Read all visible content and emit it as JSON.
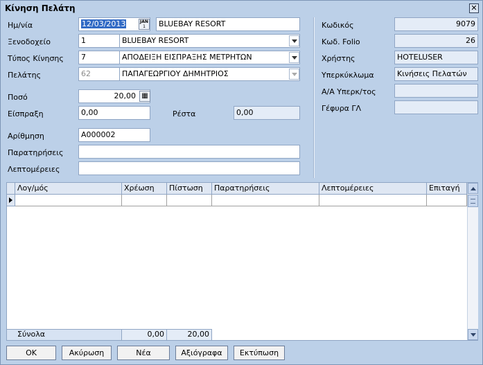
{
  "window": {
    "title": "Κίνηση Πελάτη",
    "close_glyph": "✕"
  },
  "form": {
    "date": {
      "label": "Ημ/νία",
      "value": "12/03/2013"
    },
    "hotel": {
      "label": "Ξενοδοχείο",
      "code": "1",
      "name": "BLUEBAY RESORT",
      "display": "BLUEBAY RESORT"
    },
    "movement_type": {
      "label": "Τύπος Κίνησης",
      "code": "7",
      "name": "ΑΠΟΔΕΙΞΗ ΕΙΣΠΡΑΞΗΣ ΜΕΤΡΗΤΩΝ"
    },
    "customer": {
      "label": "Πελάτης",
      "code": "62",
      "name": "ΠΑΠΑΓΕΩΡΓΙΟΥ ΔΗΜΗΤΡΙΟΣ"
    },
    "amount": {
      "label": "Ποσό",
      "value": "20,00"
    },
    "collection": {
      "label": "Είσπραξη",
      "value": "0,00"
    },
    "change": {
      "label": "Ρέστα",
      "value": "0,00"
    },
    "number": {
      "label": "Αρίθμηση",
      "value": "A000002"
    },
    "remarks": {
      "label": "Παρατηρήσεις",
      "value": ""
    },
    "details": {
      "label": "Λεπτομέρειες",
      "value": ""
    }
  },
  "info": {
    "code": {
      "label": "Κωδικός",
      "value": "9079"
    },
    "folio_code": {
      "label": "Κωδ. Folio",
      "value": "26"
    },
    "user": {
      "label": "Χρήστης",
      "value": "HOTELUSER"
    },
    "subcycle": {
      "label": "Υπερκύκλωμα",
      "value": "Κινήσεις Πελατών"
    },
    "subcycle_no": {
      "label": "Α/Α Υπερκ/τος",
      "value": ""
    },
    "gl_bridge": {
      "label": "Γέφυρα ΓΛ",
      "value": ""
    }
  },
  "grid": {
    "columns": [
      "Λογ/μός",
      "Χρέωση",
      "Πίστωση",
      "Παρατηρήσεις",
      "Λεπτομέρειες",
      "Επιταγή"
    ],
    "rows": [
      [
        "",
        "",
        "",
        "",
        "",
        ""
      ]
    ],
    "totals": {
      "label": "Σύνολα",
      "debit": "0,00",
      "credit": "20,00"
    }
  },
  "buttons": {
    "ok": "OK",
    "cancel": "Ακύρωση",
    "new": "Νέα",
    "cheques": "Αξιόγραφα",
    "print": "Εκτύπωση"
  },
  "icons": {
    "calendar_icon_text": "JAN\n1",
    "calculator_icon_text": "▦"
  }
}
